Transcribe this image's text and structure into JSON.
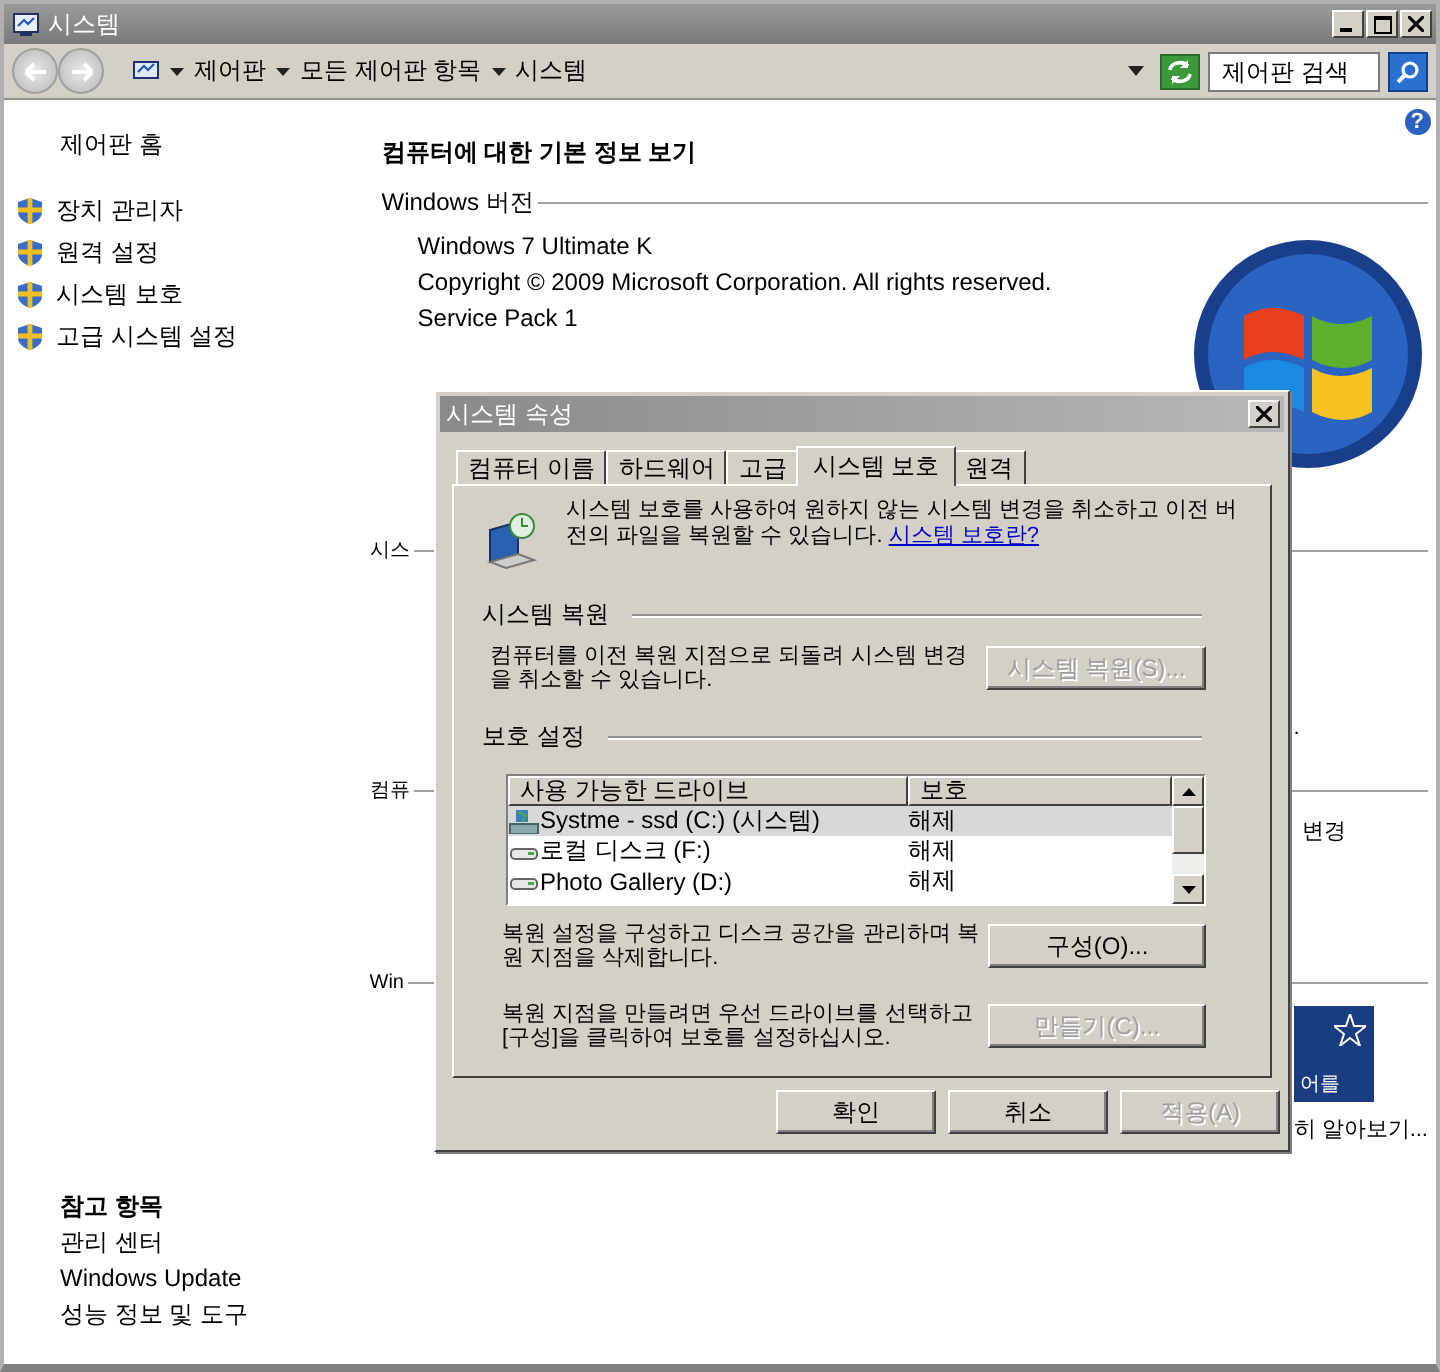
{
  "window": {
    "title": "시스템"
  },
  "address": {
    "path": [
      "제어판",
      "모든 제어판 항목",
      "시스템"
    ],
    "search_placeholder": "제어판 검색"
  },
  "help": "?",
  "sidebar": {
    "home": "제어판 홈",
    "items": [
      {
        "label": "장치 관리자"
      },
      {
        "label": "원격 설정"
      },
      {
        "label": "시스템 보호"
      },
      {
        "label": "고급 시스템 설정"
      }
    ],
    "see_also": {
      "title": "참고 항목",
      "links": [
        "관리 센터",
        "Windows Update",
        "성능 정보 및 도구"
      ]
    }
  },
  "main": {
    "heading": "컴퓨터에 대한 기본 정보 보기",
    "edition": {
      "label": "Windows 버전",
      "lines": [
        "Windows 7 Ultimate K",
        "Copyright © 2009 Microsoft Corporation. All rights reserved.",
        "Service Pack 1"
      ]
    },
    "sections": [
      {
        "label": "시스",
        "right": [
          "."
        ]
      },
      {
        "label": "컴퓨",
        "right": [
          "변경"
        ]
      },
      {
        "label": "Win",
        "tile": "어를",
        "right": [
          "히 알아보기..."
        ]
      }
    ]
  },
  "dialog": {
    "title": "시스템 속성",
    "tabs": [
      {
        "label": "컴퓨터 이름",
        "selected": false
      },
      {
        "label": "하드웨어",
        "selected": false
      },
      {
        "label": "고급",
        "selected": false
      },
      {
        "label": "시스템 보호",
        "selected": true
      },
      {
        "label": "원격",
        "selected": false
      }
    ],
    "intro": "시스템 보호를 사용하여 원하지 않는 시스템 변경을 취소하고 이전 버전의 파일을 복원할 수 있습니다.",
    "intro_link": "시스템 보호란?",
    "restore": {
      "title": "시스템 복원",
      "desc": "컴퓨터를 이전 복원 지점으로 되돌려 시스템 변경을 취소할 수 있습니다.",
      "button": {
        "label": "시스템 복원(S)...",
        "disabled": true
      }
    },
    "protection": {
      "title": "보호 설정",
      "columns": [
        "사용 가능한 드라이브",
        "보호"
      ],
      "drives": [
        {
          "kind": "system",
          "name": "Systme - ssd (C:) (시스템)",
          "status": "해제",
          "selected": true
        },
        {
          "kind": "disk",
          "name": "로컬 디스크 (F:)",
          "status": "해제",
          "selected": false
        },
        {
          "kind": "disk",
          "name": "Photo Gallery (D:)",
          "status": "해제",
          "selected": false
        }
      ]
    },
    "configure": {
      "desc": "복원 설정을 구성하고 디스크 공간을 관리하며 복원 지점을 삭제합니다.",
      "button": {
        "label": "구성(O)...",
        "disabled": false
      }
    },
    "create": {
      "desc": "복원 지점을 만들려면 우선 드라이브를 선택하고 [구성]을 클릭하여 보호를 설정하십시오.",
      "button": {
        "label": "만들기(C)...",
        "disabled": true
      }
    },
    "buttons": [
      {
        "label": "확인",
        "disabled": false
      },
      {
        "label": "취소",
        "disabled": false
      },
      {
        "label": "적용(A)",
        "disabled": true
      }
    ]
  }
}
